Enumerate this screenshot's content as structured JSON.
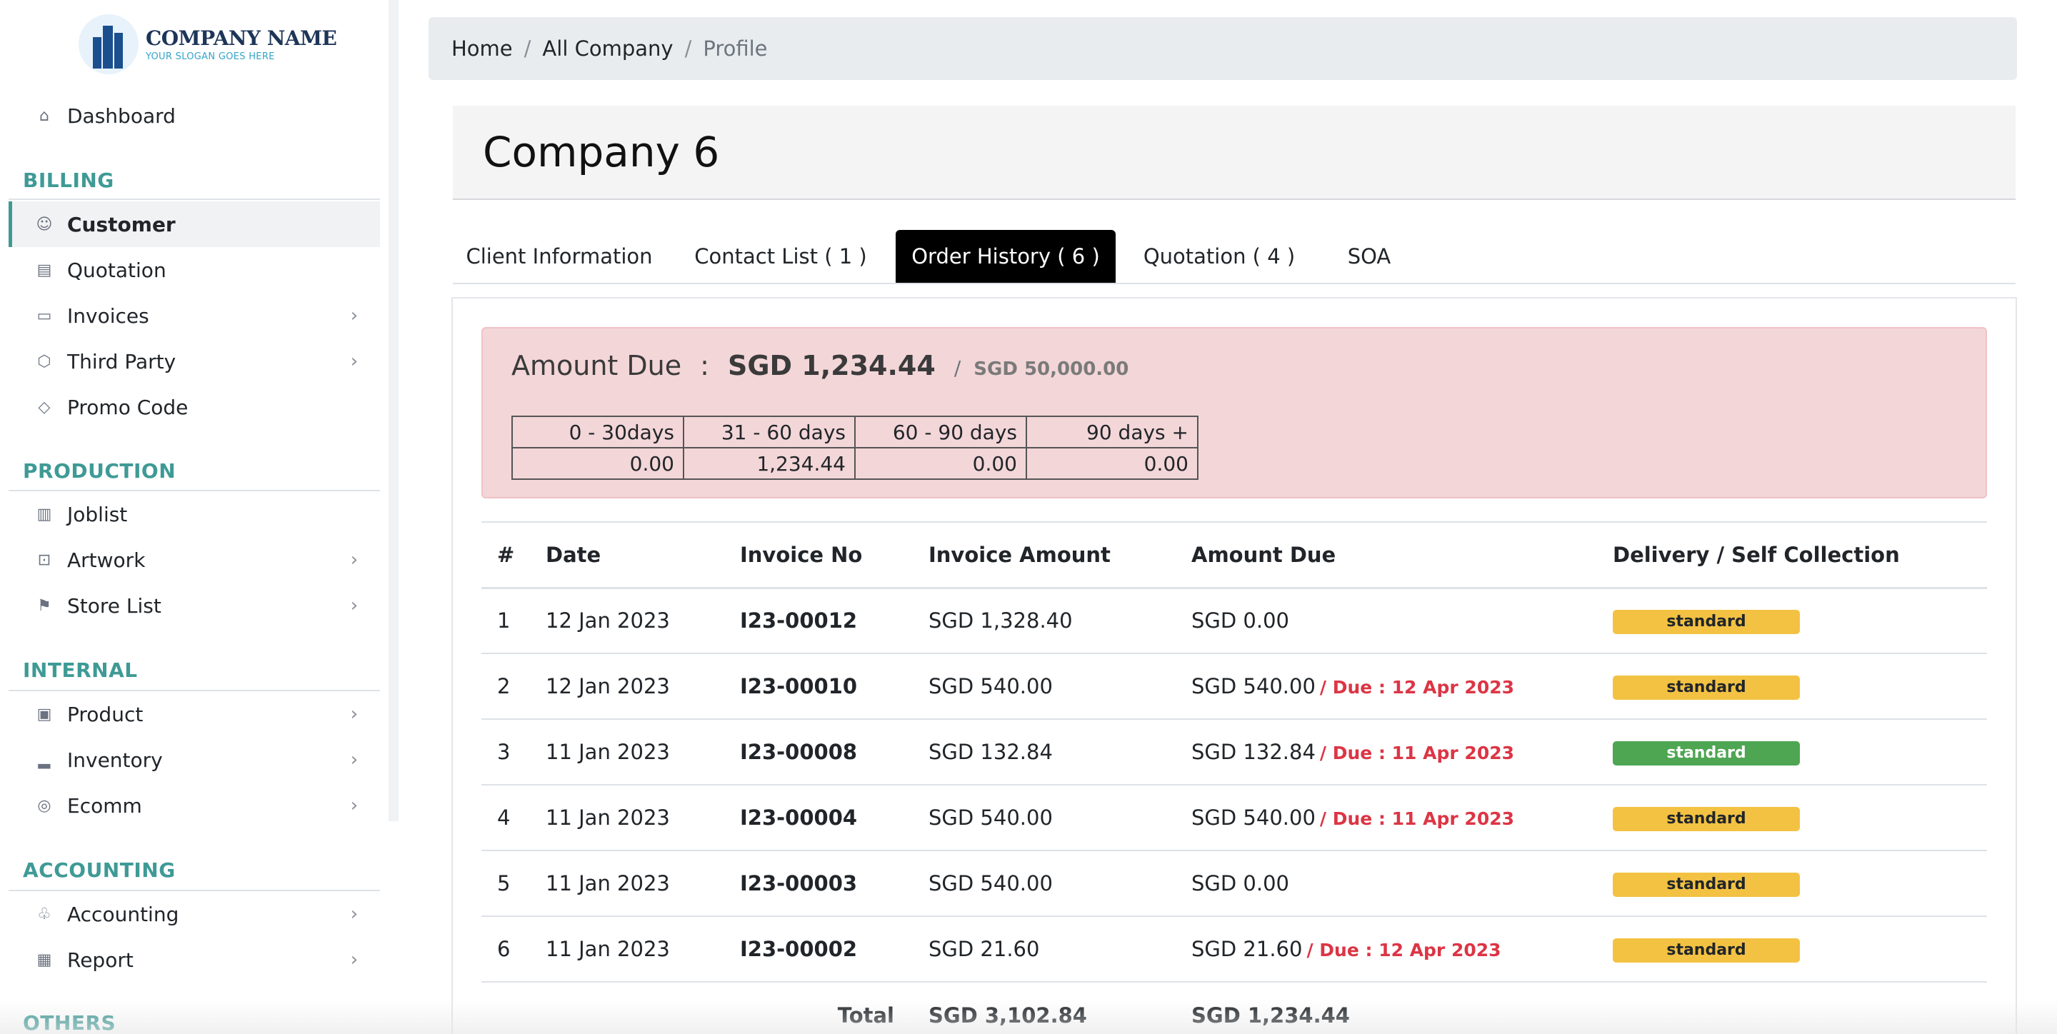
{
  "brand": {
    "name": "COMPANY NAME",
    "slogan": "YOUR SLOGAN GOES HERE"
  },
  "sidebar": {
    "dashboard": {
      "label": "Dashboard",
      "icon": "home-icon"
    },
    "sections": [
      {
        "title": "BILLING",
        "items": [
          {
            "label": "Customer",
            "icon": "users-icon",
            "active": true,
            "chevron": false
          },
          {
            "label": "Quotation",
            "icon": "document-icon",
            "chevron": false
          },
          {
            "label": "Invoices",
            "icon": "money-icon",
            "chevron": true
          },
          {
            "label": "Third Party",
            "icon": "box-icon",
            "chevron": true
          },
          {
            "label": "Promo Code",
            "icon": "tag-icon",
            "chevron": false
          }
        ]
      },
      {
        "title": "PRODUCTION",
        "items": [
          {
            "label": "Joblist",
            "icon": "clipboard-icon",
            "chevron": false
          },
          {
            "label": "Artwork",
            "icon": "inbox-icon",
            "chevron": true
          },
          {
            "label": "Store List",
            "icon": "store-icon",
            "chevron": true
          }
        ]
      },
      {
        "title": "INTERNAL",
        "items": [
          {
            "label": "Product",
            "icon": "archive-icon",
            "chevron": true
          },
          {
            "label": "Inventory",
            "icon": "bar-chart-icon",
            "chevron": true
          },
          {
            "label": "Ecomm",
            "icon": "globe-icon",
            "chevron": true
          }
        ]
      },
      {
        "title": "ACCOUNTING",
        "items": [
          {
            "label": "Accounting",
            "icon": "piggy-bank-icon",
            "chevron": true
          },
          {
            "label": "Report",
            "icon": "report-icon",
            "chevron": true
          }
        ]
      },
      {
        "title": "OTHERS",
        "items": []
      }
    ]
  },
  "breadcrumb": [
    "Home",
    "All Company",
    "Profile"
  ],
  "company": {
    "title": "Company 6"
  },
  "tabs": [
    {
      "label": "Client Information"
    },
    {
      "label": "Contact List ( 1 )"
    },
    {
      "label": "Order History ( 6 )",
      "active": true
    },
    {
      "label": "Quotation ( 4 )"
    },
    {
      "label": "SOA"
    }
  ],
  "amount_due": {
    "label": "Amount Due",
    "colon": ":",
    "amount": "SGD 1,234.44",
    "separator": "/",
    "limit": "SGD 50,000.00",
    "aging": {
      "headers": [
        "0 - 30days",
        "31 - 60 days",
        "60 - 90 days",
        "90 days +"
      ],
      "values": [
        "0.00",
        "1,234.44",
        "0.00",
        "0.00"
      ]
    }
  },
  "orders": {
    "columns": [
      "#",
      "Date",
      "Invoice No",
      "Invoice Amount",
      "Amount Due",
      "Delivery / Self Collection"
    ],
    "rows": [
      {
        "n": "1",
        "date": "12 Jan 2023",
        "invoice": "I23-00012",
        "amount": "SGD 1,328.40",
        "due": "SGD 0.00",
        "due_note": "",
        "delivery": "standard",
        "badge_color": "#f3c243"
      },
      {
        "n": "2",
        "date": "12 Jan 2023",
        "invoice": "I23-00010",
        "amount": "SGD 540.00",
        "due": "SGD 540.00",
        "due_note": "/ Due : 12 Apr 2023",
        "delivery": "standard",
        "badge_color": "#f3c243"
      },
      {
        "n": "3",
        "date": "11 Jan 2023",
        "invoice": "I23-00008",
        "amount": "SGD 132.84",
        "due": "SGD 132.84",
        "due_note": "/ Due : 11 Apr 2023",
        "delivery": "standard",
        "badge_color": "#4ea552"
      },
      {
        "n": "4",
        "date": "11 Jan 2023",
        "invoice": "I23-00004",
        "amount": "SGD 540.00",
        "due": "SGD 540.00",
        "due_note": "/ Due : 11 Apr 2023",
        "delivery": "standard",
        "badge_color": "#f3c243"
      },
      {
        "n": "5",
        "date": "11 Jan 2023",
        "invoice": "I23-00003",
        "amount": "SGD 540.00",
        "due": "SGD 0.00",
        "due_note": "",
        "delivery": "standard",
        "badge_color": "#f3c243"
      },
      {
        "n": "6",
        "date": "11 Jan 2023",
        "invoice": "I23-00002",
        "amount": "SGD 21.60",
        "due": "SGD 21.60",
        "due_note": "/ Due : 12 Apr 2023",
        "delivery": "standard",
        "badge_color": "#f3c243"
      }
    ],
    "total": {
      "label": "Total",
      "amount": "SGD 3,102.84",
      "due": "SGD 1,234.44"
    }
  },
  "colors": {
    "accent": "#3f9a96",
    "due_red": "#dc3545",
    "due_box_bg": "#f3d6d8",
    "active_tab": "#000000"
  }
}
